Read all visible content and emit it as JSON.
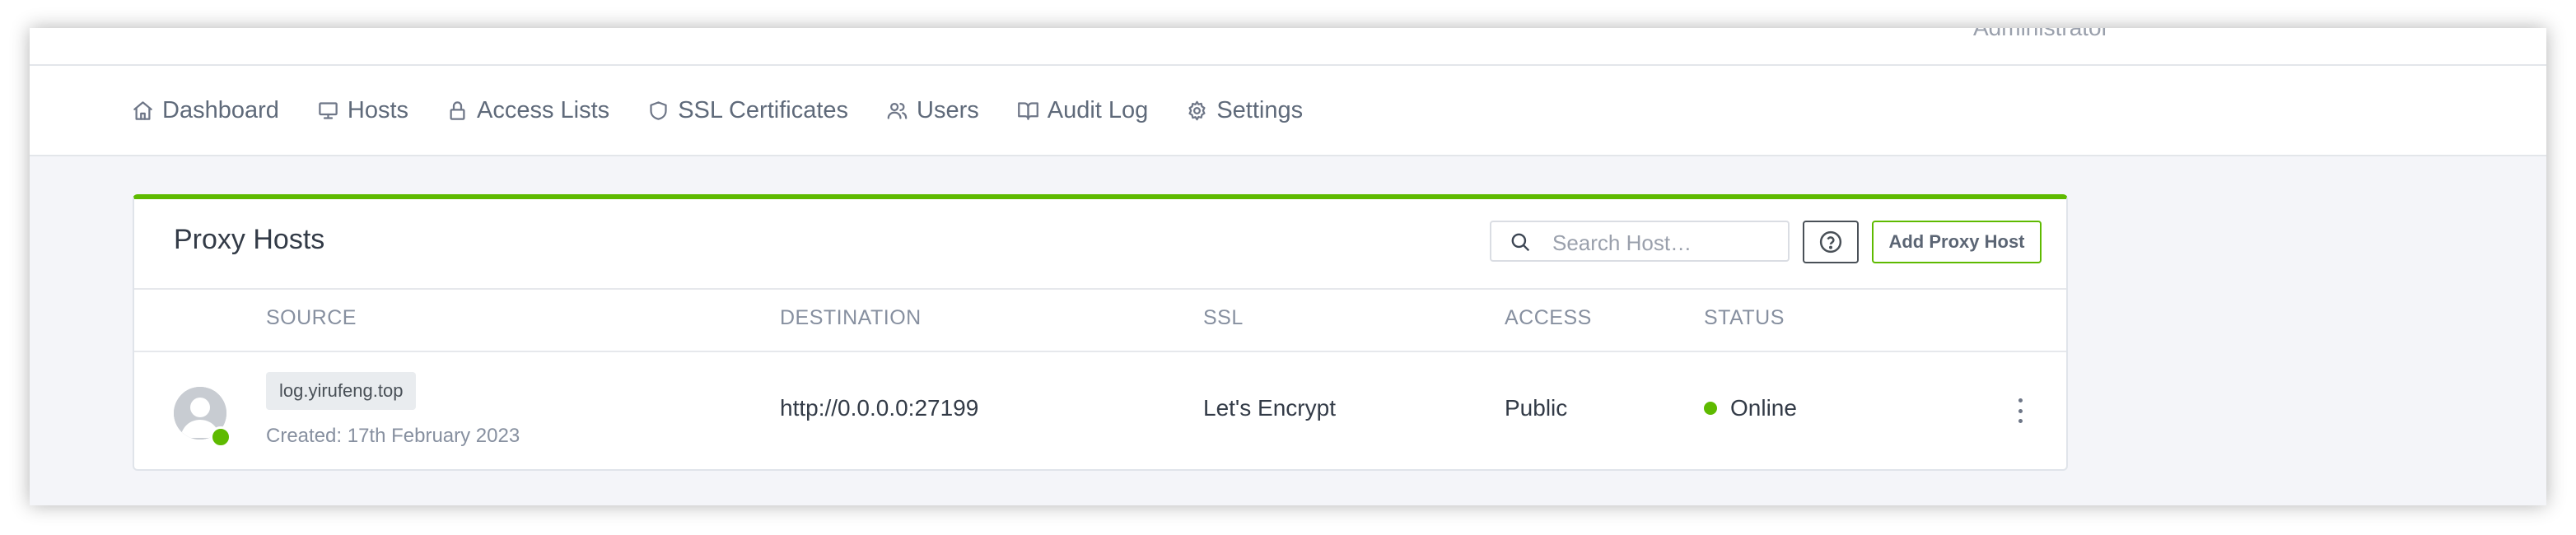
{
  "header": {
    "user_role_cut": "Administrator"
  },
  "nav": {
    "items": [
      {
        "label": "Dashboard",
        "icon": "home-icon"
      },
      {
        "label": "Hosts",
        "icon": "monitor-icon"
      },
      {
        "label": "Access Lists",
        "icon": "lock-icon"
      },
      {
        "label": "SSL Certificates",
        "icon": "shield-icon"
      },
      {
        "label": "Users",
        "icon": "users-icon"
      },
      {
        "label": "Audit Log",
        "icon": "book-open-icon"
      },
      {
        "label": "Settings",
        "icon": "gear-icon"
      }
    ]
  },
  "card": {
    "title": "Proxy Hosts",
    "search_placeholder": "Search Host…",
    "help_icon": "help-circle-icon",
    "add_label": "Add Proxy Host",
    "accent_color": "#5eba00"
  },
  "table": {
    "columns": [
      "SOURCE",
      "DESTINATION",
      "SSL",
      "ACCESS",
      "STATUS"
    ],
    "rows": [
      {
        "source": "log.yirufeng.top",
        "created": "Created: 17th February 2023",
        "destination": "http://0.0.0.0:27199",
        "ssl": "Let's Encrypt",
        "access": "Public",
        "status": "Online",
        "status_color": "#5eba00"
      }
    ]
  }
}
